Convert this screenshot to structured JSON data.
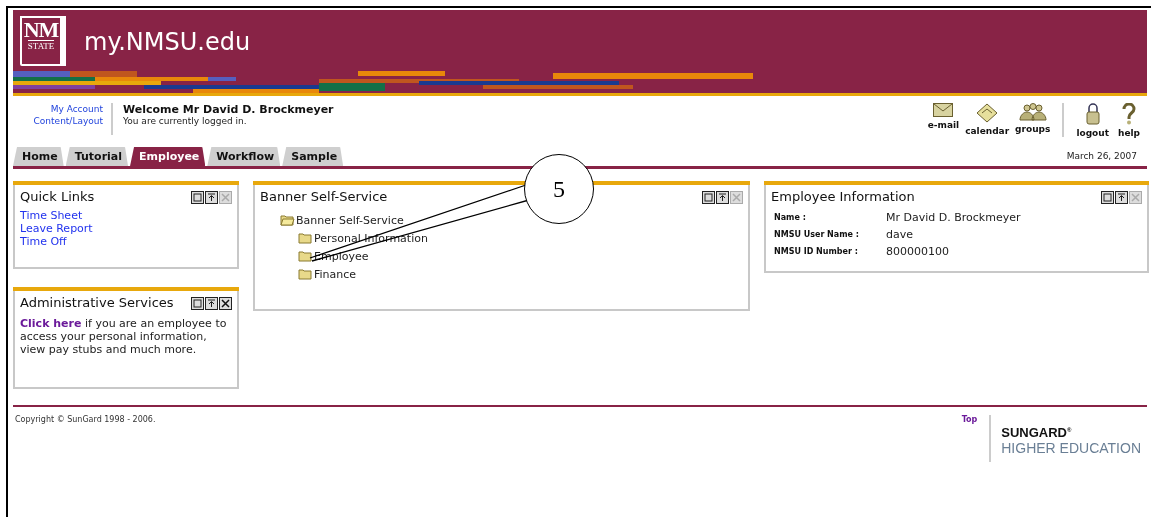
{
  "header": {
    "logo": {
      "line_1": "NM",
      "line_2": "STATE"
    },
    "site_title": "my.NMSU.edu"
  },
  "account_links": [
    "My Account",
    "Content/Layout"
  ],
  "welcome": {
    "greeting": "Welcome Mr David D. Brockmeyer",
    "status": "You are currently logged in."
  },
  "toolbar": [
    {
      "kind": "email",
      "label": "e-mail"
    },
    {
      "kind": "calendar",
      "label": "calendar"
    },
    {
      "kind": "groups",
      "label": "groups"
    },
    {
      "kind": "divider"
    },
    {
      "kind": "logout",
      "label": "logout"
    },
    {
      "kind": "help",
      "label": "help"
    }
  ],
  "tabs": [
    {
      "label": "Home",
      "selected": false
    },
    {
      "label": "Tutorial",
      "selected": false
    },
    {
      "label": "Employee",
      "selected": true
    },
    {
      "label": "Workflow",
      "selected": false
    },
    {
      "label": "Sample",
      "selected": false
    }
  ],
  "date": "March 26, 2007",
  "columns": [
    [
      {
        "kind": "links",
        "title": "Quick Links",
        "close_disabled": true,
        "links": [
          "Time Sheet",
          "Leave Report",
          "Time Off"
        ]
      },
      {
        "kind": "text",
        "title": "Administrative Services",
        "close_disabled": false,
        "link": "Click here",
        "text": " if you are an employee to access your personal information, view pay stubs and much more."
      }
    ],
    [
      {
        "kind": "tree",
        "title": "Banner Self-Service",
        "close_disabled": true,
        "tree": [
          {
            "label": "Banner Self-Service",
            "expanded": true,
            "children": [
              {
                "label": "Personal Information",
                "expanded": false
              },
              {
                "label": "Employee",
                "expanded": false
              },
              {
                "label": "Finance",
                "expanded": false
              }
            ]
          }
        ]
      }
    ],
    [
      {
        "kind": "info",
        "title": "Employee Information",
        "close_disabled": true,
        "fields": [
          {
            "label": "Name :",
            "value": "Mr David D. Brockmeyer"
          },
          {
            "label": "NMSU User Name :",
            "value": "dave"
          },
          {
            "label": "NMSU ID Number :",
            "value": "800000100"
          }
        ]
      }
    ]
  ],
  "footer": {
    "copyright": "Copyright © SunGard 1998 - 2006.",
    "top_link": "Top",
    "brand_line_1": "SUNGARD",
    "brand_mark": "®",
    "brand_line_2": "HIGHER EDUCATION"
  },
  "callout": {
    "label": "5"
  }
}
